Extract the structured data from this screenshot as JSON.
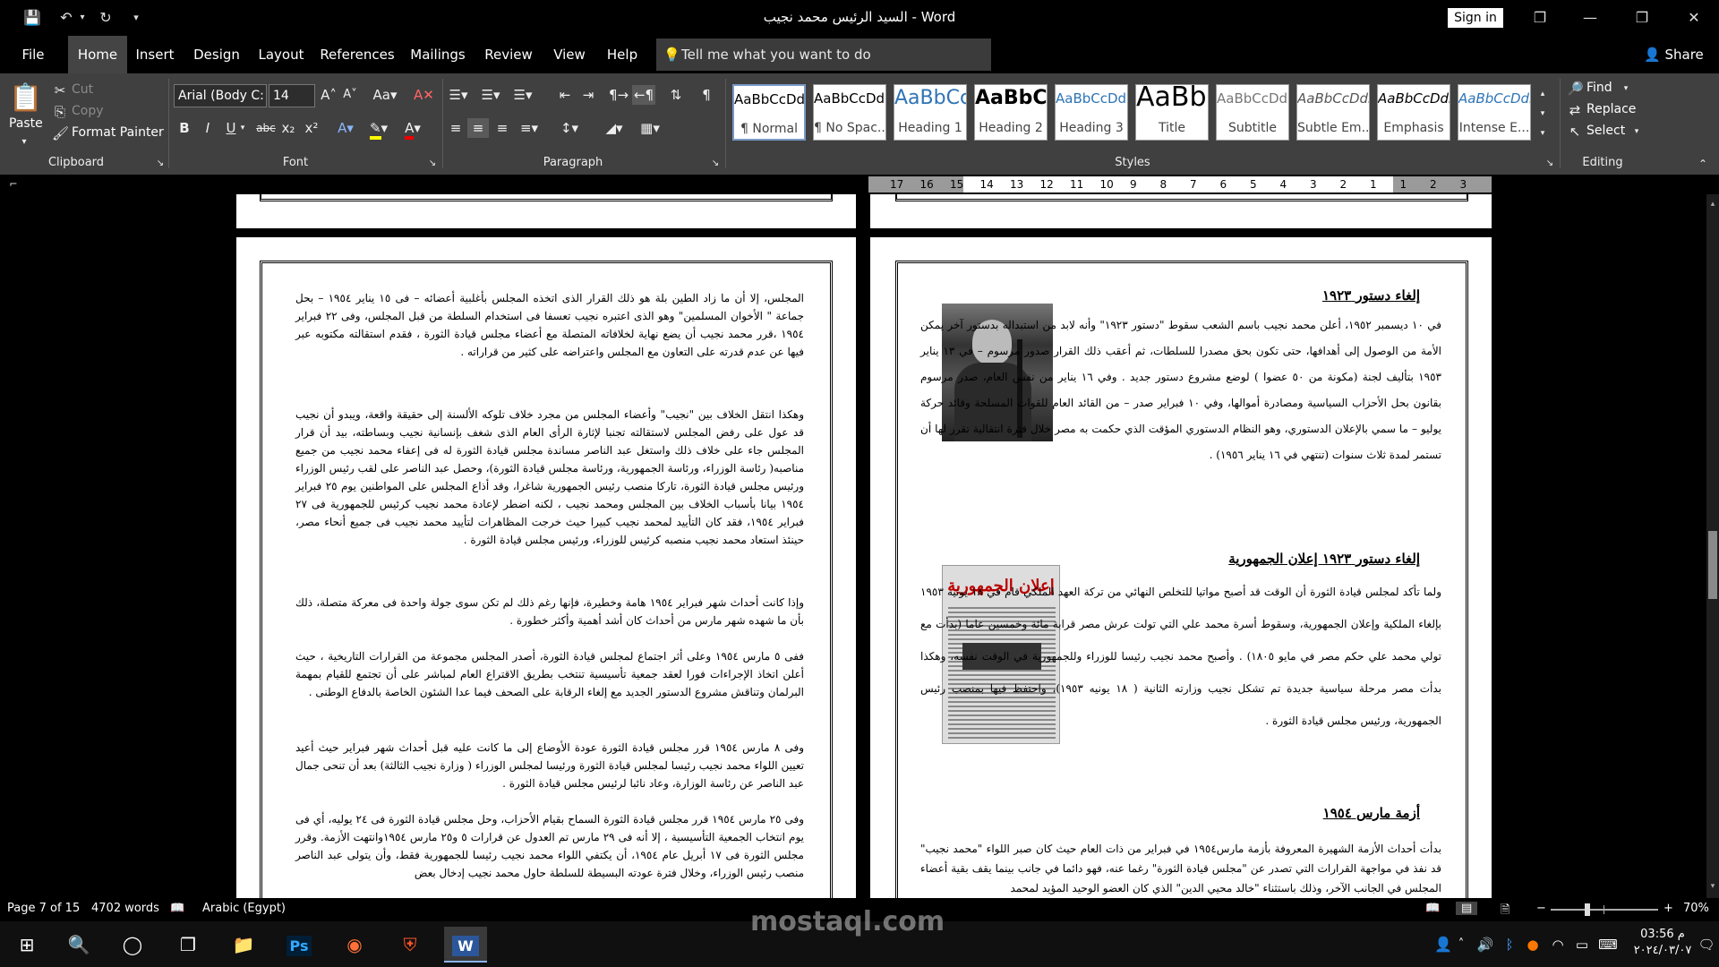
{
  "window": {
    "title": "السيد الرئيس محمد نجيب  -  Word",
    "signin": "Sign in"
  },
  "tabs": [
    "File",
    "Home",
    "Insert",
    "Design",
    "Layout",
    "References",
    "Mailings",
    "Review",
    "View",
    "Help"
  ],
  "active_tab": "Home",
  "tellme": "Tell me what you want to do",
  "share": "Share",
  "ribbon": {
    "clipboard": {
      "paste": "Paste",
      "cut": "Cut",
      "copy": "Copy",
      "format_painter": "Format Painter",
      "label": "Clipboard"
    },
    "font": {
      "name": "Arial (Body C:",
      "size": "14",
      "label": "Font"
    },
    "paragraph": {
      "label": "Paragraph"
    },
    "styles": {
      "label": "Styles",
      "items": [
        {
          "sample": "AaBbCcDdEe",
          "name": "¶ Normal"
        },
        {
          "sample": "AaBbCcDdEe",
          "name": "¶ No Spac..."
        },
        {
          "sample": "AaBbCcDdEe",
          "name": "Heading 1"
        },
        {
          "sample": "AaBbCcDdEe",
          "name": "Heading 2"
        },
        {
          "sample": "AaBbCcDdEe",
          "name": "Heading 3"
        },
        {
          "sample": "AaBbCcDdEe",
          "name": "Title"
        },
        {
          "sample": "AaBbCcDdEe",
          "name": "Subtitle"
        },
        {
          "sample": "AaBbCcDdEe",
          "name": "Subtle Em..."
        },
        {
          "sample": "AaBbCcDdEe",
          "name": "Emphasis"
        },
        {
          "sample": "AaBbCcDdEe",
          "name": "Intense E..."
        }
      ]
    },
    "editing": {
      "find": "Find",
      "replace": "Replace",
      "select": "Select",
      "label": "Editing"
    }
  },
  "ruler_labels": [
    "17",
    "16",
    "15",
    "14",
    "13",
    "12",
    "11",
    "10",
    "9",
    "8",
    "7",
    "6",
    "5",
    "4",
    "3",
    "2",
    "1",
    "1",
    "2",
    "3"
  ],
  "left_page": {
    "paragraphs": [
      "المجلس، إلا أن ما زاد الطين بلة هو ذلك القرار الذى اتخذه المجلس بأغلبية أعضائه – فى ١٥ يناير ١٩٥٤ – بحل جماعة \" الأخوان المسلمين\" وهو الذى اعتبره نجيب تعسفا فى استخدام السلطة من قبل المجلس، وفى ٢٢ فبراير ١٩٥٤ ،قرر محمد نجيب أن يضع نهاية لخلافاته المتصلة مع أعضاء مجلس قيادة الثورة ، فقدم استقالته مكتوبه عبر فيها عن عدم قدرته على التعاون مع المجلس واعتراضه على كثير من قراراته .",
      "وهكذا انتقل الخلاف بين \"نجيب\" وأعضاء المجلس من مجرد خلاف تلوكه الألسنة إلى حقيقة واقعة، ويبدو أن نجيب قد عول على رفض المجلس لاستقالته تجنبا لإثارة الرأى العام الذى شغف بإنسانية نجيب وبساطته، بيد أن قرار المجلس جاء على خلاف ذلك واستغل عبد الناصر مساندة مجلس قيادة الثورة له فى إعفاء محمد نجيب من جميع مناصبه( رئاسة الوزراء، ورئاسة الجمهورية، ورئاسة مجلس قيادة الثورة)، وحصل عبد الناصر على لقب رئيس الوزراء ورئيس مجلس قيادة الثورة، تاركا منصب رئيس الجمهورية شاغرا، وقد أذاع المجلس على المواطنين يوم ٢٥ فبراير ١٩٥٤ بيانا بأسباب الخلاف بين المجلس ومحمد نجيب ، لكنه اضطر لإعادة محمد نجيب كرئيس للجمهورية فى ٢٧ فبراير ١٩٥٤، فقد كان التأييد لمحمد نجيب كبيرا حيث خرجت المظاهرات لتأييد محمد نجيب فى جميع أنحاء مصر، حينئذ استعاد محمد نجيب منصبه كرئيس للوزراء، ورئيس مجلس قيادة الثورة .",
      "وإذا كانت أحداث شهر فبراير ١٩٥٤ هامة وخطيرة، فإنها رغم ذلك لم تكن سوى جولة واحدة فى معركة متصلة، ذلك بأن ما شهده شهر مارس من أحداث كان أشد أهمية وأكثر خطورة .",
      "ففى ٥ مارس ١٩٥٤ وعلى أثر اجتماع لمجلس قيادة الثورة، أصدر المجلس مجموعة من القرارات التاريخية ، حيث أعلن اتخاذ الإجراءات فورا لعقد جمعية تأسيسية تنتخب بطريق الاقتراع العام لمباشر على أن تجتمع للقيام بمهمة البرلمان وتناقش مشروع الدستور الجديد مع إلغاء الرقابة على الصحف فيما عدا الشئون الخاصة بالدفاع الوطنى .",
      "وفى ٨ مارس ١٩٥٤ قرر مجلس قيادة الثورة عودة الأوضاع إلى ما كانت عليه قبل أحداث شهر فبراير حيث أعيد تعيين اللواء محمد نجيب رئيسا لمجلس قيادة الثورة ورئيسا لمجلس الوزراء ( وزارة نجيب الثالثة) بعد أن تنحى جمال عبد الناصر عن رئاسة الوزارة، وعاد نائبا لرئيس مجلس قيادة الثورة .",
      "وفى ٢٥ مارس ١٩٥٤ قرر مجلس قيادة الثورة السماح بقيام الأحزاب، وحل مجلس قيادة الثورة فى ٢٤ يوليه، أي فى يوم انتخاب الجمعية التأسيسية ، إلا أنه فى ٢٩ مارس تم العدول عن قرارات ٥ و٢٥ مارس ١٩٥٤وانتهت الأزمة. وقرر مجلس الثورة فى ١٧ أبريل عام ١٩٥٤، أن يكتفي اللواء محمد نجيب رئيسا للجمهورية فقط، وأن يتولى عبد الناصر منصب رئيس الوزراء، وخلال فترة عودته البسيطة للسلطة حاول محمد نجيب إدخال بعض"
    ]
  },
  "right_page": {
    "heading1": "إلغاء دستور ١٩٢٣",
    "para1": "في ١٠ ديسمبر ١٩٥٢، أعلن محمد نجيب باسم الشعب سقوط \"دستور ١٩٢٣\" وأنه لابد من استبداله بدستور آخر يمكن الأمة من الوصول إلى أهدافها، حتى تكون بحق مصدرا للسلطات، ثم أعقب ذلك القرار صدور مرسوم – في ١٣ يناير ١٩٥٣ بتأليف لجنة (مكونة من ٥٠ عضوا ) لوضع مشروع دستور جديد . وفي ١٦ يناير من نفس العام، صدر مرسوم بقانون بحل الأحزاب السياسية ومصادرة أموالها، وفي ١٠ فبراير صدر – من القائد العام للقوات المسلحة وقائد حركة يوليو – ما سمي بالإعلان الدستوري، وهو النظام الدستوري المؤقت الذي حكمت به مصر خلال فترة انتقالية تقرر لها أن تستمر لمدة ثلاث سنوات (تنتهي في ١٦ يناير ١٩٥٦) .",
    "heading2": "إلغاء دستور ١٩٢٣ إعلان الجمهورية",
    "para2": "ولما تأكد لمجلس قيادة الثورة أن الوقت قد أصبح مواتيا للتخلص النهائي من تركة العهد الملكي قام في ١٨ يونيه ١٩٥٣ بإلغاء الملكية وإعلان الجمهورية، وسقوط أسرة محمد علي التي تولت عرش مصر قرابة مائة وخمسين عاما (بدأت مع تولي محمد علي حكم مصر في مايو ١٨٠٥) . وأصبح محمد نجيب رئيسا للوزراء وللجمهورية في الوقت نفسه، وهكذا بدأت مصر مرحلة سياسية جديدة تم تشكل نجيب وزارته الثانية ( ١٨ يونيه ١٩٥٣)، واحتفظ فيها بمنصب رئيس الجمهورية، ورئيس مجلس قيادة الثورة .",
    "heading3": "أزمة مارس ١٩٥٤",
    "para3": "بدأت أحداث الأزمة الشهيرة المعروفة بأزمة مارس١٩٥٤ في فبراير من ذات العام حيث كان صبر اللواء \"محمد نجيب\" قد نفذ في مواجهة القرارات التي تصدر عن \"مجلس قيادة الثورة\" رغما عنه، فهو دائما في جانب بينما يقف بقية أعضاء المجلس في الجانب الآخر، وذلك باستثناء \"خالد محيي الدين\" الذي كان العضو الوحيد المؤيد لمحمد",
    "newspaper_headline": "إعلان الجمهورية"
  },
  "status": {
    "page": "Page 7 of 15",
    "words": "4702 words",
    "language": "Arabic (Egypt)",
    "zoom": "70%"
  },
  "taskbar": {
    "time": "03:56 م",
    "date": "٢٠٢٤/٠٣/٠٧"
  },
  "watermark": "mostaql.com"
}
